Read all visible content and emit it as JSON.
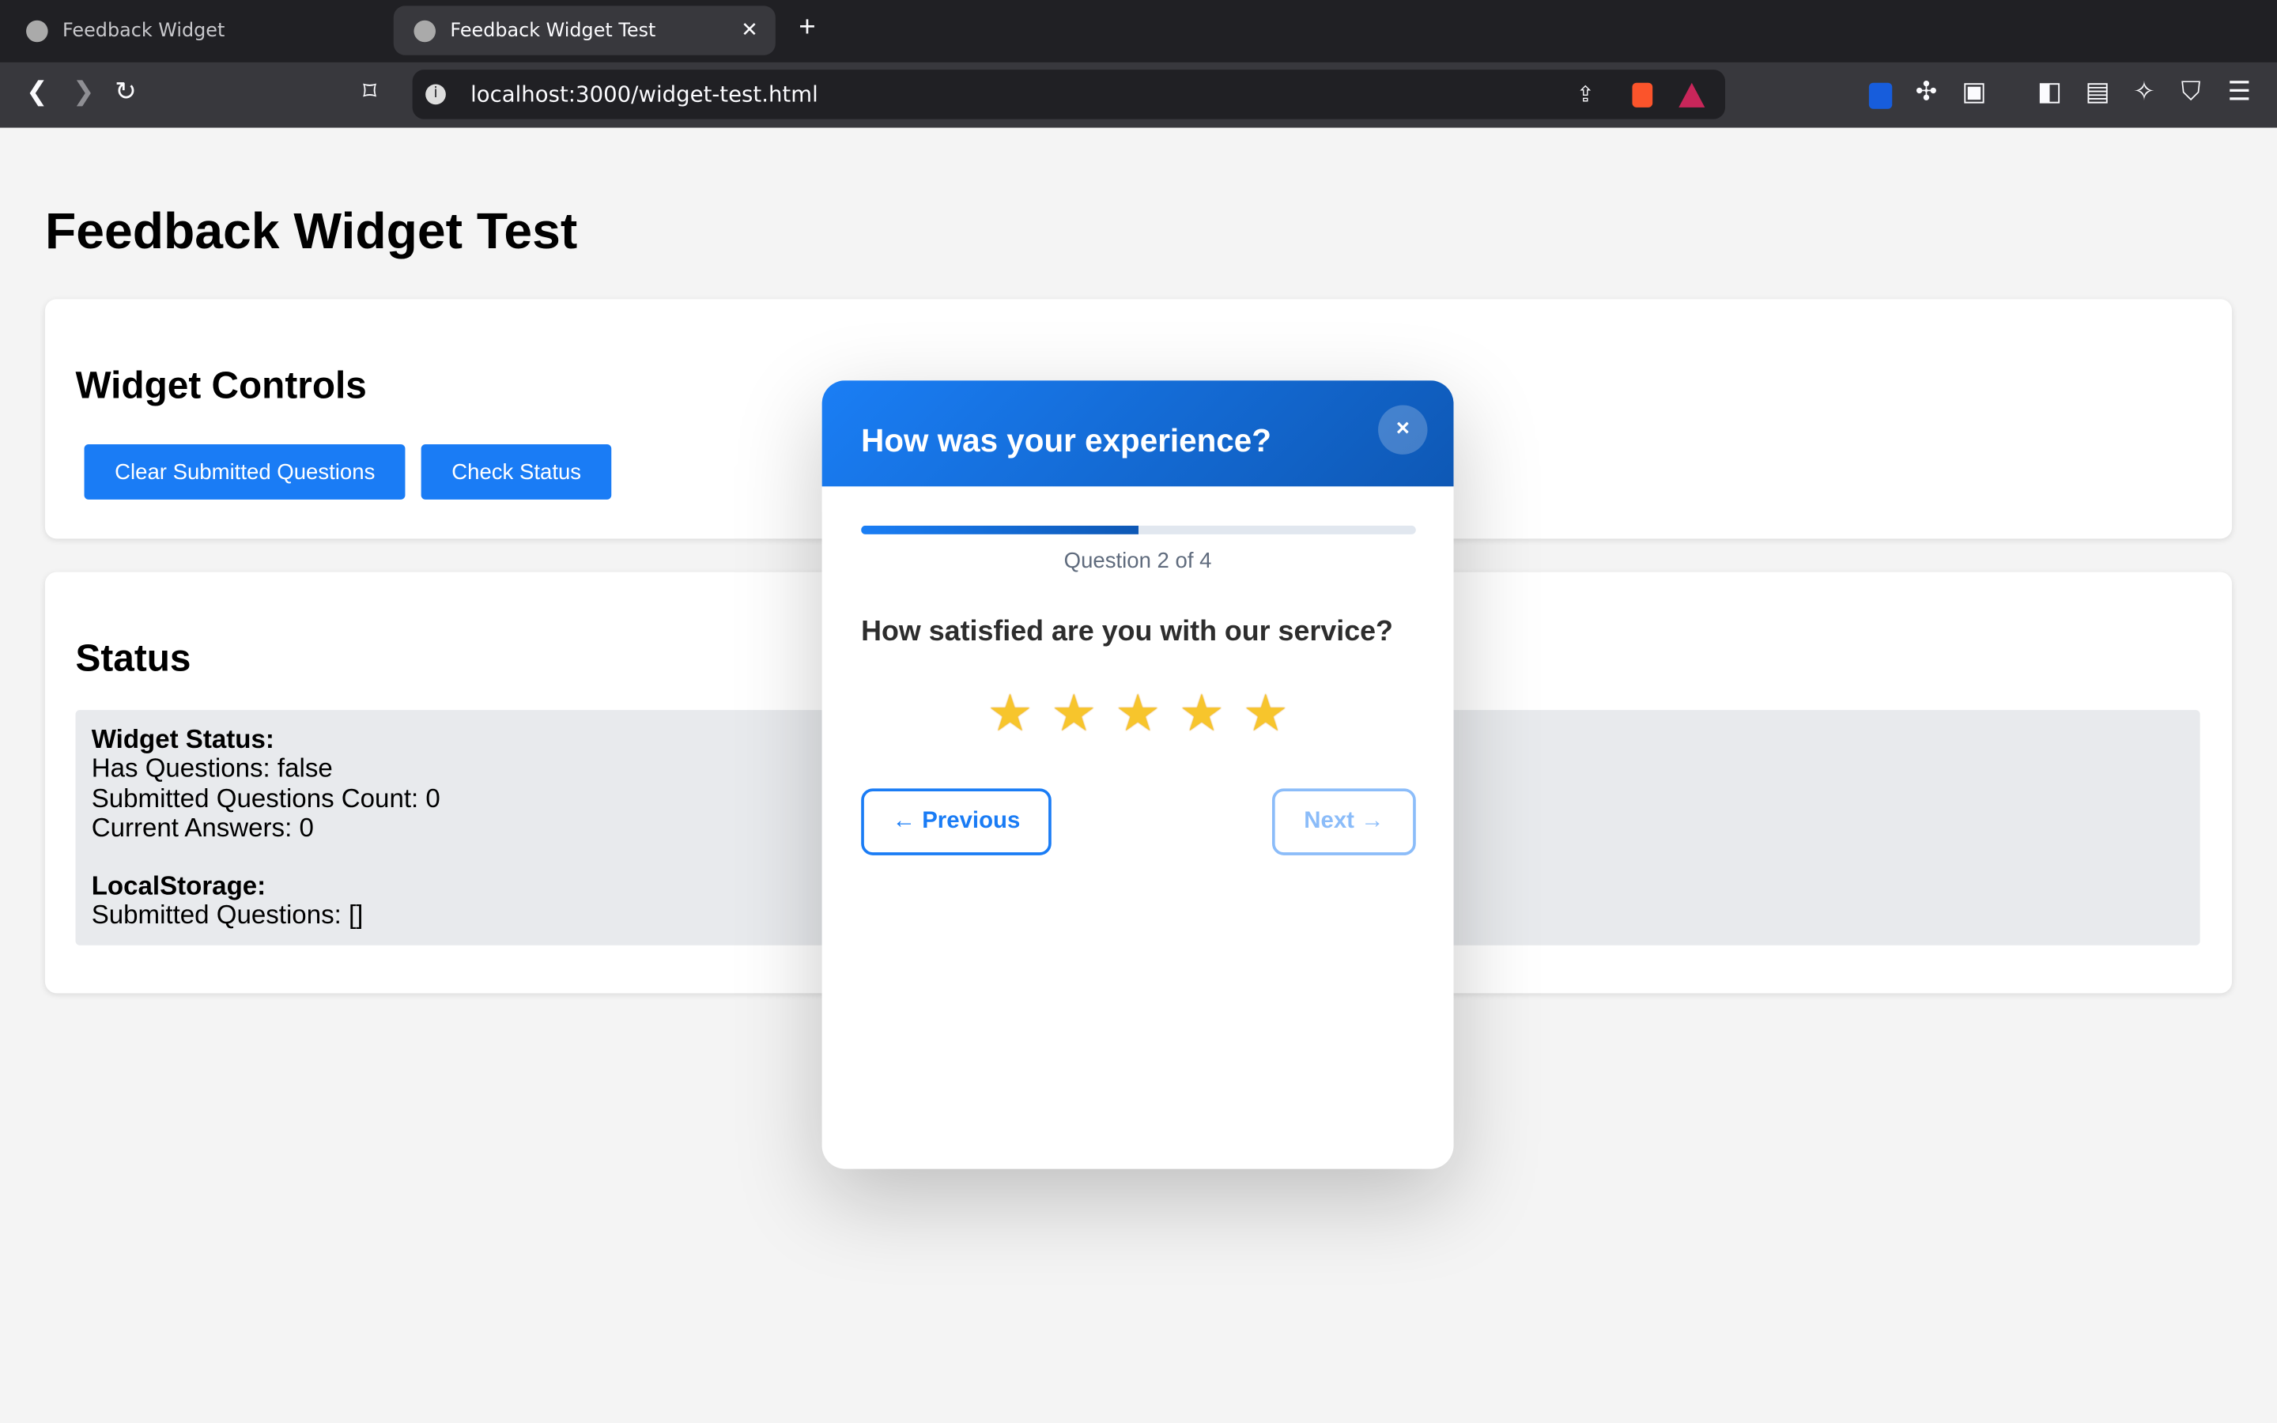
{
  "browser": {
    "tabs": [
      {
        "title": "Feedback Widget",
        "active": false
      },
      {
        "title": "Feedback Widget Test",
        "active": true
      }
    ],
    "url": "localhost:3000/widget-test.html"
  },
  "page": {
    "title": "Feedback Widget Test",
    "controls": {
      "heading": "Widget Controls",
      "clear_label": "Clear Submitted Questions",
      "check_label": "Check Status"
    },
    "status": {
      "heading": "Status",
      "widget_status_label": "Widget Status:",
      "has_questions": "Has Questions: false",
      "submitted_count": "Submitted Questions Count: 0",
      "current_answers": "Current Answers: 0",
      "localstorage_label": "LocalStorage:",
      "submitted_questions": "Submitted Questions: []"
    }
  },
  "modal": {
    "title": "How was your experience?",
    "close_label": "×",
    "progress_percent": 50,
    "question_counter": "Question 2 of 4",
    "question": "How satisfied are you with our service?",
    "rating_max": 5,
    "previous_label": "← Previous",
    "next_label": "Next →",
    "accent": "#1a7cf5"
  }
}
